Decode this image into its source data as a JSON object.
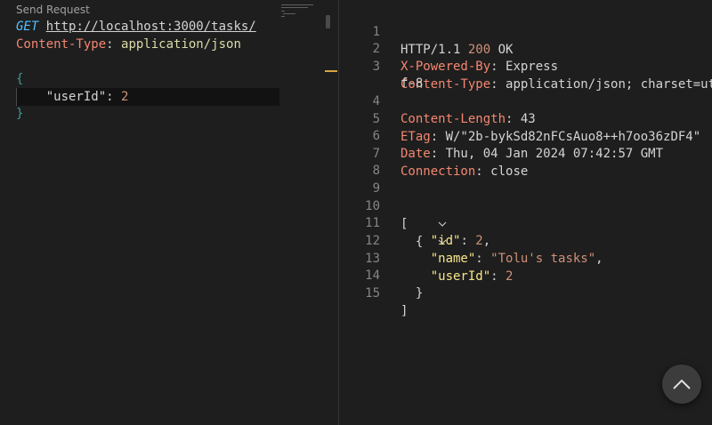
{
  "request": {
    "codelens": "Send Request",
    "method": "GET",
    "url": "http://localhost:3000/tasks/",
    "header_key": "Content-Type",
    "header_sep": ": ",
    "header_value": "application/json",
    "body_open": "{",
    "body_key": "\"userId\"",
    "body_colon": ": ",
    "body_value": "2",
    "body_close": "}"
  },
  "response": {
    "line_numbers": [
      "1",
      "2",
      "3",
      "",
      "4",
      "5",
      "6",
      "7",
      "8",
      "9",
      "10",
      "11",
      "12",
      "13",
      "14",
      "15"
    ],
    "status_proto": "HTTP/1.1 ",
    "status_code": "200",
    "status_text": " OK",
    "headers": [
      {
        "key": "X-Powered-By",
        "value": "Express"
      },
      {
        "key": "Content-Type",
        "value": "application/json; charset=ut"
      },
      {
        "key": "Content-Length",
        "value": "43"
      },
      {
        "key": "ETag",
        "value": "W/\"2b-bykSd82nFCsAuo8++h7oo36zDF4\""
      },
      {
        "key": "Date",
        "value": "Thu, 04 Jan 2024 07:42:57 GMT"
      },
      {
        "key": "Connection",
        "value": "close"
      }
    ],
    "content_type_wrap": "f-8",
    "body": {
      "open_bracket": "[",
      "open_brace": "{",
      "id_key": "\"id\"",
      "id_value": "2",
      "name_key": "\"name\"",
      "name_value": "\"Tolu's tasks\"",
      "userid_key": "\"userId\"",
      "userid_value": "2",
      "close_brace": "}",
      "close_bracket": "]"
    }
  },
  "icons": {
    "fold": "chevron-down-icon",
    "scroll_top": "chevron-up-icon"
  },
  "colors": {
    "background": "#1e1e1e",
    "header_key": "#f48771",
    "json_key": "#f8e58a",
    "string": "#ce9178",
    "method": "#4fc1ff"
  }
}
